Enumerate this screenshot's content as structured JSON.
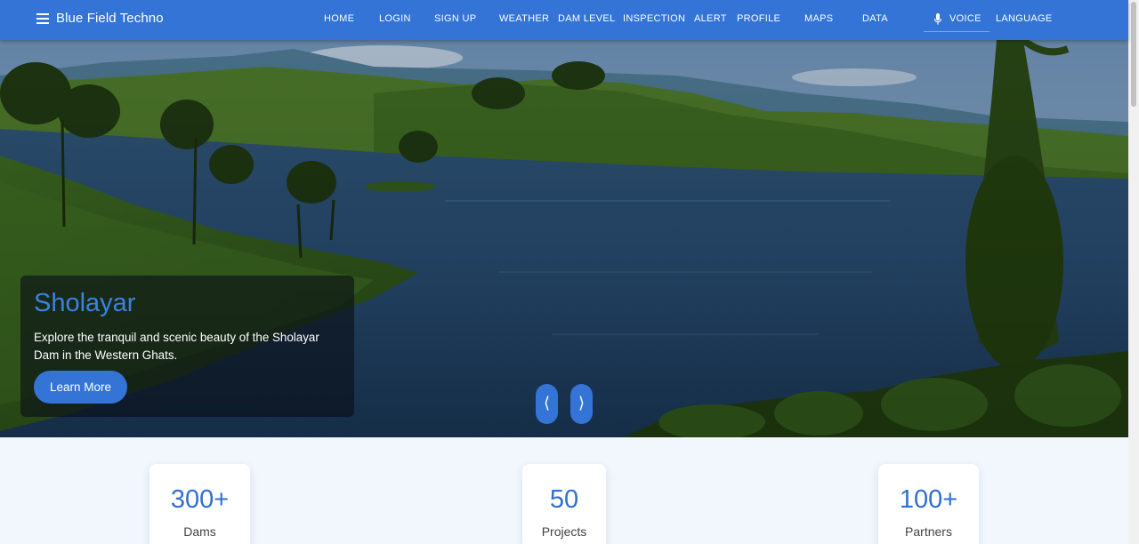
{
  "header": {
    "brand": "Blue Field Techno",
    "nav": [
      "HOME",
      "LOGIN",
      "SIGN UP",
      "WEATHER",
      "DAM LEVEL",
      "INSPECTION",
      "ALERT",
      "PROFILE",
      "MAPS",
      "DATA"
    ],
    "voice_label": "VOICE",
    "language_label": "LANGUAGE"
  },
  "hero": {
    "title": "Sholayar",
    "description": "Explore the tranquil and scenic beauty of the Sholayar Dam in the Western Ghats.",
    "button_label": "Learn More",
    "prev_icon": "⟨",
    "next_icon": "⟩"
  },
  "stats": [
    {
      "value": "300+",
      "label": "Dams"
    },
    {
      "value": "50",
      "label": "Projects"
    },
    {
      "value": "100+",
      "label": "Partners"
    }
  ],
  "colors": {
    "primary": "#3374d6",
    "accent_text": "#2f6fcf",
    "page_bg": "#f2f7fe"
  }
}
